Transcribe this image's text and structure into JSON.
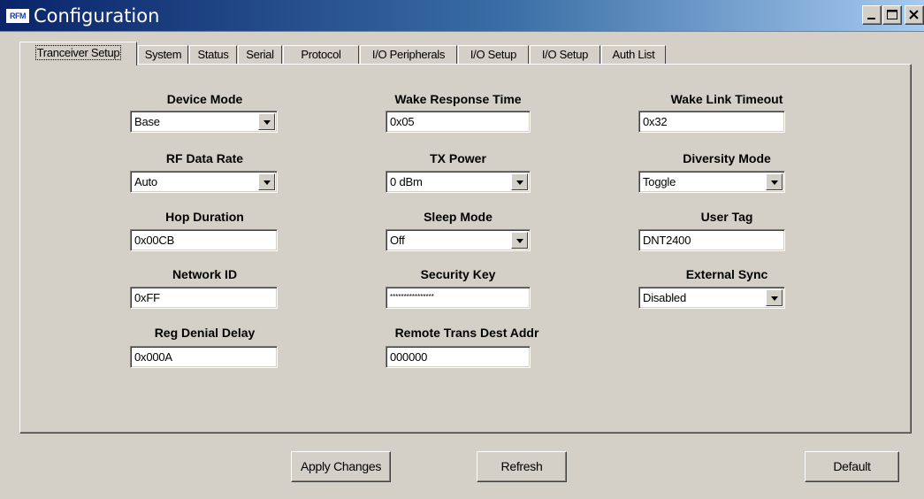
{
  "window": {
    "title": "Configuration",
    "icon_text": "RFM",
    "icon": "app-icon",
    "controls": [
      "minimize-icon",
      "maximize-icon",
      "close-icon"
    ]
  },
  "tabs": [
    {
      "label": "Tranceiver Setup",
      "active": true
    },
    {
      "label": "System"
    },
    {
      "label": "Status"
    },
    {
      "label": "Serial"
    },
    {
      "label": "Protocol"
    },
    {
      "label": "I/O Peripherals"
    },
    {
      "label": "I/O Setup"
    },
    {
      "label": "I/O Setup"
    },
    {
      "label": "Auth List"
    }
  ],
  "fields": {
    "device_mode": {
      "label": "Device Mode",
      "value": "Base",
      "type": "select"
    },
    "rf_data_rate": {
      "label": "RF Data Rate",
      "value": "Auto",
      "type": "select"
    },
    "hop_duration": {
      "label": "Hop Duration",
      "value": "0x00CB",
      "type": "text"
    },
    "network_id": {
      "label": "Network ID",
      "value": "0xFF",
      "type": "text"
    },
    "reg_denial_delay": {
      "label": "Reg Denial Delay",
      "value": "0x000A",
      "type": "text"
    },
    "wake_response_time": {
      "label": "Wake Response Time",
      "value": "0x05",
      "type": "text"
    },
    "tx_power": {
      "label": "TX Power",
      "value": "0 dBm",
      "type": "select"
    },
    "sleep_mode": {
      "label": "Sleep Mode",
      "value": "Off",
      "type": "select"
    },
    "security_key": {
      "label": "Security Key",
      "value": "****************",
      "type": "password"
    },
    "remote_trans_dest_addr": {
      "label": "Remote Trans Dest Addr",
      "value": "000000",
      "type": "text"
    },
    "wake_link_timeout": {
      "label": "Wake Link Timeout",
      "value": "0x32",
      "type": "text"
    },
    "diversity_mode": {
      "label": "Diversity Mode",
      "value": "Toggle",
      "type": "select"
    },
    "user_tag": {
      "label": "User Tag",
      "value": "DNT2400",
      "type": "text"
    },
    "external_sync": {
      "label": "External Sync",
      "value": "Disabled",
      "type": "select"
    }
  },
  "buttons": {
    "apply": "Apply Changes",
    "refresh": "Refresh",
    "default": "Default"
  },
  "colors": {
    "titlebar_start": "#0a246a",
    "titlebar_end": "#a6caf0",
    "face": "#d4d0c8"
  }
}
